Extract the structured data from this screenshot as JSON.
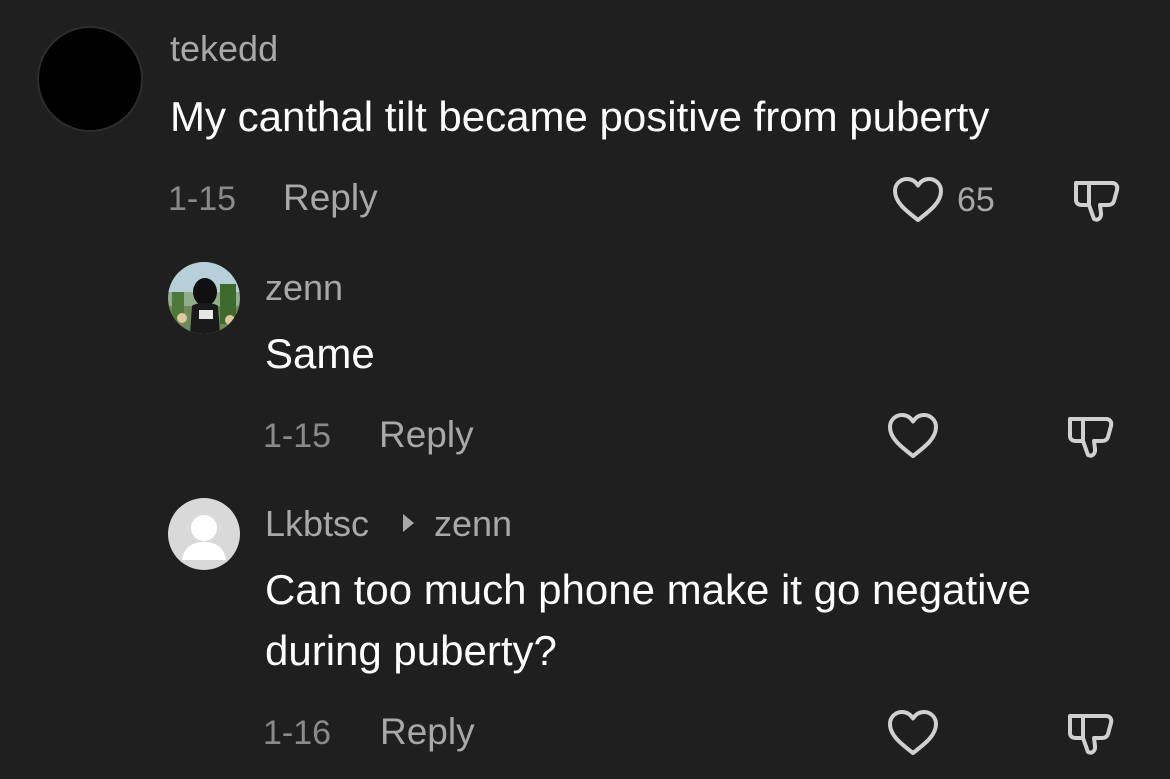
{
  "comments": [
    {
      "username": "tekedd",
      "text": "My canthal tilt became positive from puberty",
      "date": "1-15",
      "reply_label": "Reply",
      "like_count": "65",
      "avatar": "black-avatar"
    },
    {
      "username": "zenn",
      "text": "Same",
      "date": "1-15",
      "reply_label": "Reply",
      "like_count": "",
      "avatar": "character-avatar"
    },
    {
      "username": "Lkbtsc",
      "reply_to": "zenn",
      "text_line1": "Can too much phone make it go negative",
      "text_line2": "during puberty?",
      "date": "1-16",
      "reply_label": "Reply",
      "like_count": "",
      "avatar": "default-avatar"
    }
  ],
  "icons": {
    "like": "heart-outline-icon",
    "dislike": "thumbs-down-icon",
    "reply_arrow": "triangle-right-icon"
  },
  "colors": {
    "background": "#1f1f1f",
    "username": "#a8a8a8",
    "text": "#ffffff",
    "meta": "#8a8a8a"
  }
}
